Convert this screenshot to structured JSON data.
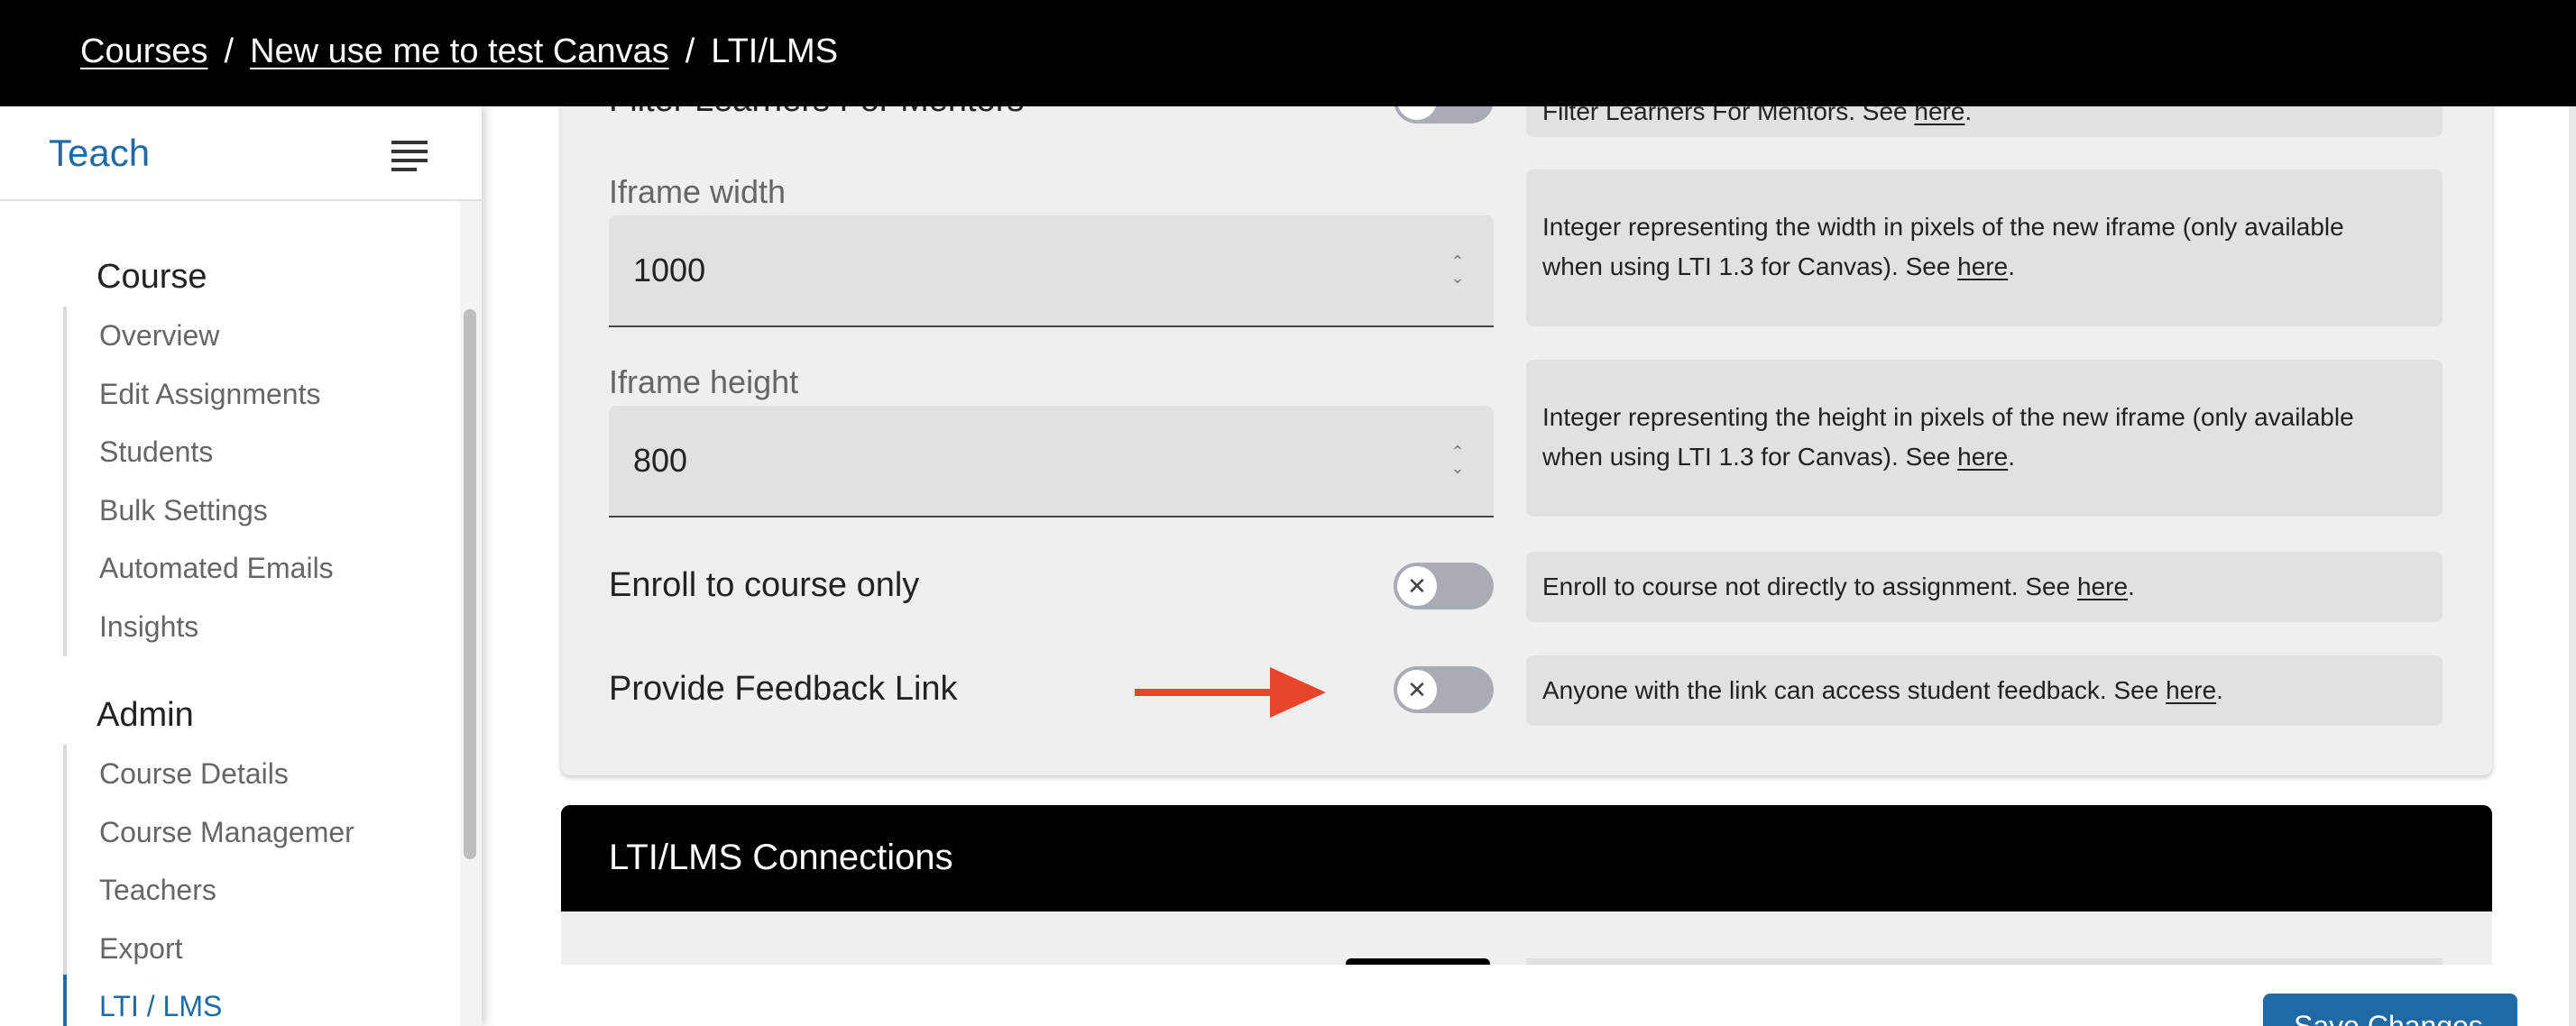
{
  "breadcrumb": {
    "items": [
      "Courses",
      "New use me to test Canvas",
      "LTI/LMS"
    ],
    "separator": "/"
  },
  "sidebar": {
    "title": "Teach",
    "sections": [
      {
        "title": "Course",
        "items": [
          "Overview",
          "Edit Assignments",
          "Students",
          "Bulk Settings",
          "Automated Emails",
          "Insights"
        ]
      },
      {
        "title": "Admin",
        "items": [
          "Course Details",
          "Course Managemer",
          "Teachers",
          "Export",
          "LTI / LMS"
        ]
      }
    ],
    "active_item": "LTI / LMS"
  },
  "settings": {
    "partial_row": {
      "label": "Filter Learners For Mentors",
      "help": "Filter Learners For Mentors. See",
      "link": "here"
    },
    "iframe_width": {
      "label": "Iframe width",
      "value": "1000",
      "help_line1": "Integer representing the width in pixels of the new iframe (only available",
      "help_line2": "when using LTI 1.3 for Canvas). See",
      "link": "here"
    },
    "iframe_height": {
      "label": "Iframe height",
      "value": "800",
      "help_line1": "Integer representing the height in pixels of the new iframe (only available",
      "help_line2": "when using LTI 1.3 for Canvas). See",
      "link": "here"
    },
    "enroll_course_only": {
      "label": "Enroll to course only",
      "enabled": false,
      "help": "Enroll to course not directly to assignment. See",
      "link": "here"
    },
    "feedback_link": {
      "label": "Provide Feedback Link",
      "enabled": false,
      "help": "Anyone with the link can access student feedback. See",
      "link": "here"
    }
  },
  "connections": {
    "title": "LTI/LMS Connections"
  },
  "footer": {
    "save_label": "Save Changes"
  },
  "icons": {
    "menu": "menu-lines-icon",
    "toggle_knob": "close-x-icon",
    "spinner": "up-down-chevron-icon",
    "annotation": "red-arrow-icon"
  },
  "colors": {
    "accent": "#1f6aa5",
    "arrow": "#e8452c",
    "toggle_off": "#a9adb3"
  }
}
